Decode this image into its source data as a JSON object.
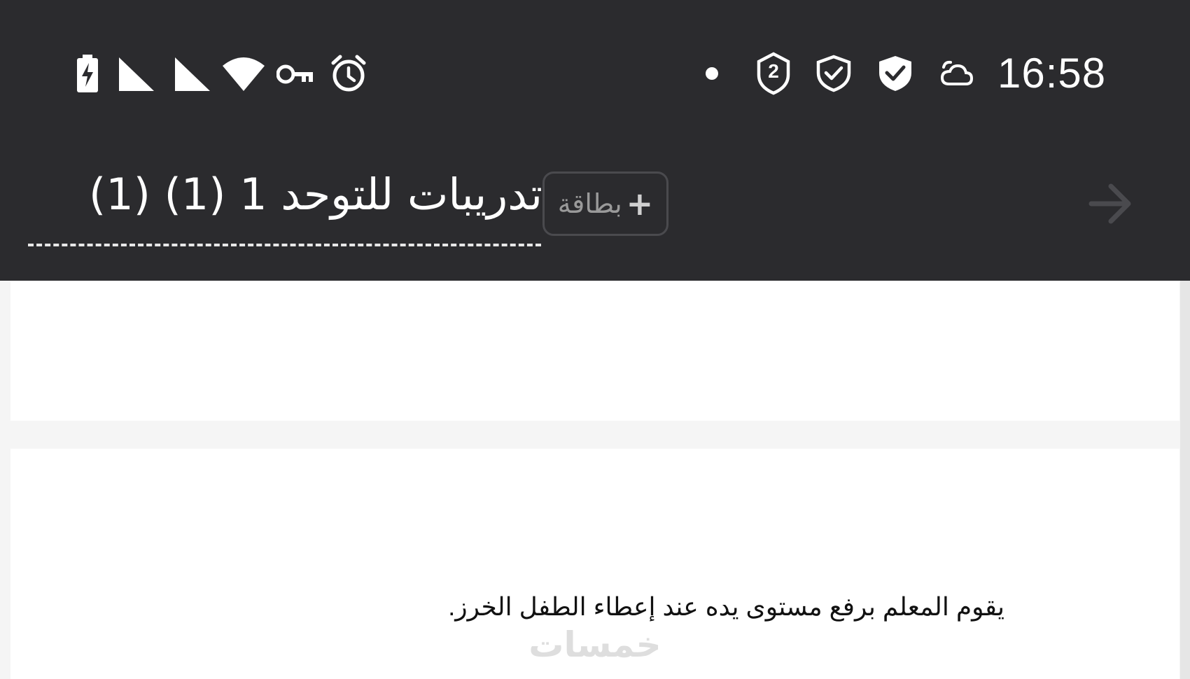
{
  "status_bar": {
    "time": "16:58",
    "badge_number": "2",
    "icons": [
      "battery-charging-icon",
      "signal-icon",
      "signal-icon",
      "wifi-icon",
      "vpn-key-icon",
      "alarm-icon",
      "notification-dot-icon",
      "shield-badge-icon",
      "shield-check-outline-icon",
      "shield-check-filled-icon",
      "cloud-icon"
    ]
  },
  "toolbar": {
    "deck_title": "تدريبات للتوحد 1 (1) (1)",
    "add_card_label": "بطاقة",
    "add_card_plus": "+"
  },
  "card": {
    "text": "يقوم المعلم برفع مستوى يده عند إعطاء الطفل الخرز."
  },
  "watermark": "خمسات",
  "colors": {
    "header_bg": "#2b2b2e",
    "content_bg": "#f5f5f5",
    "card_bg": "#ffffff",
    "title_text": "#ffffff"
  }
}
